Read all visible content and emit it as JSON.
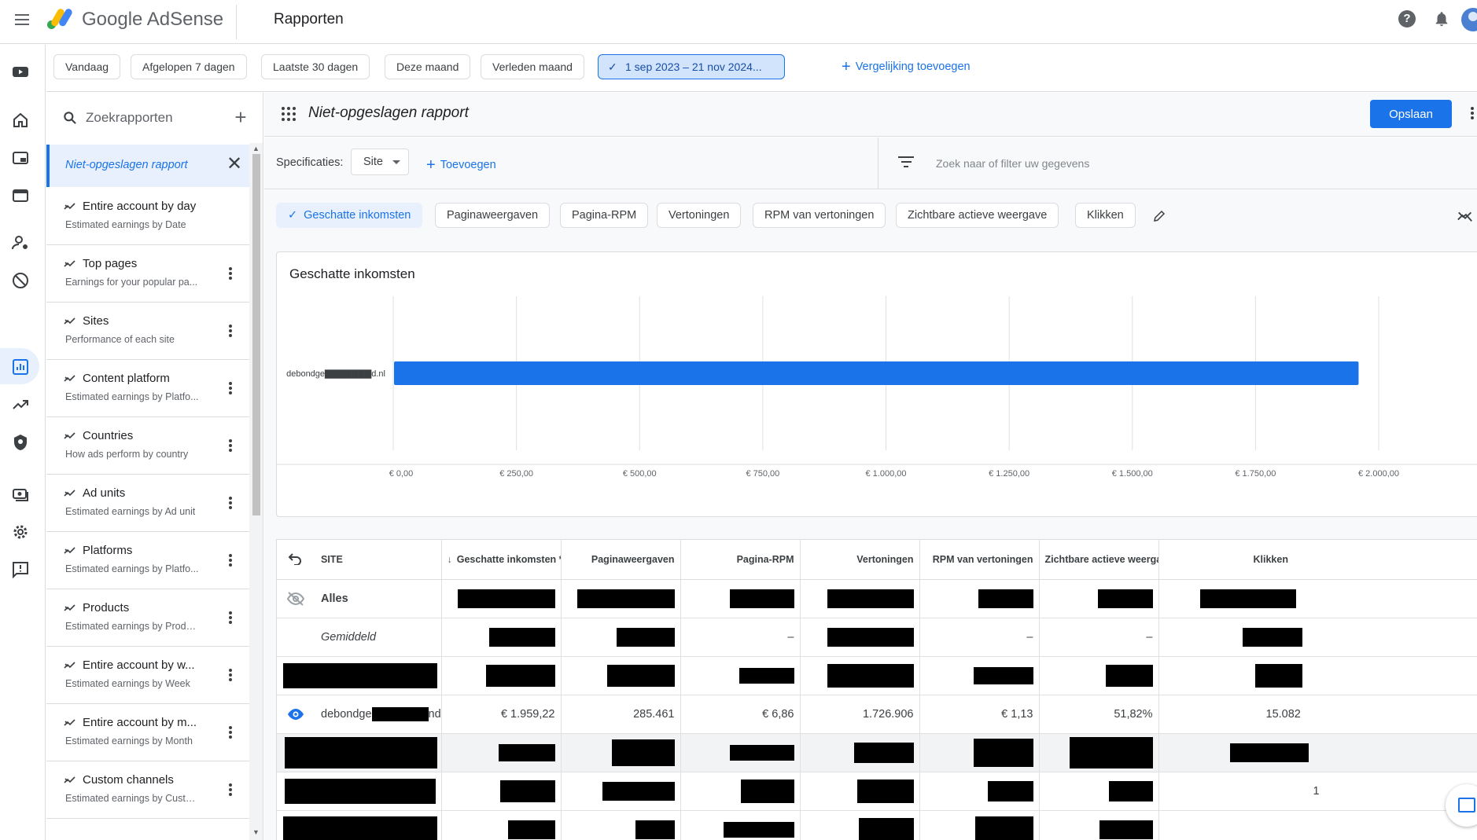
{
  "topbar": {
    "brand_google": "Google",
    "brand_adsense": "AdSense",
    "title": "Rapporten"
  },
  "date_chips": [
    "Vandaag",
    "Afgelopen 7 dagen",
    "Laatste 30 dagen",
    "Deze maand",
    "Verleden maand"
  ],
  "date_selected": "1 sep 2023 – 21 nov 2024...",
  "compare_link": "Vergelijking toevoegen",
  "search": {
    "placeholder": "Zoekrapporten"
  },
  "active_report": "Niet-opgeslagen rapport",
  "reports": [
    {
      "title": "Entire account by day",
      "subtitle": "Estimated earnings by Date"
    },
    {
      "title": "Top pages",
      "subtitle": "Earnings for your popular pa..."
    },
    {
      "title": "Sites",
      "subtitle": "Performance of each site"
    },
    {
      "title": "Content platform",
      "subtitle": "Estimated earnings by Platfo..."
    },
    {
      "title": "Countries",
      "subtitle": "How ads perform by country"
    },
    {
      "title": "Ad units",
      "subtitle": "Estimated earnings by Ad unit"
    },
    {
      "title": "Platforms",
      "subtitle": "Estimated earnings by Platfo..."
    },
    {
      "title": "Products",
      "subtitle": "Estimated earnings by Produ..."
    },
    {
      "title": "Entire account by w...",
      "subtitle": "Estimated earnings by Week"
    },
    {
      "title": "Entire account by m...",
      "subtitle": "Estimated earnings by Month"
    },
    {
      "title": "Custom channels",
      "subtitle": "Estimated earnings by Custo..."
    }
  ],
  "report_header": {
    "name": "Niet-opgeslagen rapport",
    "save_label": "Opslaan"
  },
  "spec": {
    "label": "Specificaties:",
    "dimension": "Site",
    "add_label": "Toevoegen",
    "filter_placeholder": "Zoek naar of filter uw gegevens"
  },
  "metrics": [
    "Geschatte inkomsten",
    "Paginaweergaven",
    "Pagina-RPM",
    "Vertoningen",
    "RPM van vertoningen",
    "Zichtbare actieve weergave",
    "Klikken"
  ],
  "chart_data": {
    "type": "bar",
    "orientation": "horizontal",
    "title": "Geschatte inkomsten",
    "categories": [
      "debondge▇▇▇▇▇▇▇d.nl"
    ],
    "series": [
      {
        "values": [
          1959.22
        ]
      }
    ],
    "xlim": [
      0,
      2000
    ],
    "x_ticks": [
      "€ 0,00",
      "€ 250,00",
      "€ 500,00",
      "€ 750,00",
      "€ 1.000,00",
      "€ 1.250,00",
      "€ 1.500,00",
      "€ 1.750,00",
      "€ 2.000,00"
    ],
    "bar_color": "#1a73e8",
    "grid": true
  },
  "table": {
    "headers": [
      "SITE",
      "Geschatte inkomsten *",
      "Paginaweergaven",
      "Pagina-RPM",
      "Vertoningen",
      "RPM van vertoningen",
      "Zichtbare actieve weergave",
      "Klikken"
    ],
    "total_label": "Alles",
    "average_label": "Gemiddeld",
    "avg_dashes": [
      "–",
      "–",
      "–"
    ],
    "site_row": {
      "site_prefix": "debondge",
      "site_suffix": "nd.nl",
      "earnings": "€ 1.959,22",
      "pageviews": "285.461",
      "page_rpm": "€ 6,86",
      "impressions": "1.726.906",
      "impression_rpm": "€ 1,13",
      "active_view": "51,82%",
      "clicks": "15.082"
    },
    "partial_click": "1"
  },
  "colors": {
    "accent": "#1a73e8",
    "selected_chip_bg": "#d2e3fc",
    "border": "#dadce0"
  }
}
